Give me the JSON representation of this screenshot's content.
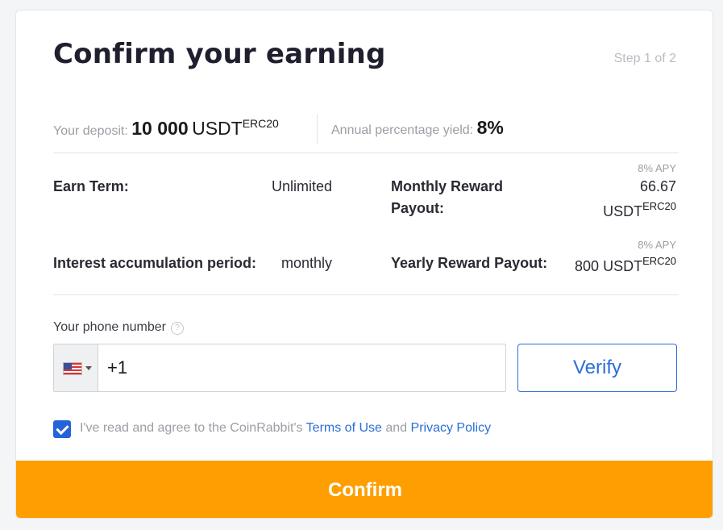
{
  "header": {
    "title": "Confirm your earning",
    "step": "Step 1 of 2"
  },
  "summary": {
    "deposit_label": "Your deposit:",
    "deposit_amount": "10 000",
    "deposit_currency": "USDT",
    "deposit_network": "ERC20",
    "apy_label": "Annual percentage yield:",
    "apy_value": "8%"
  },
  "details": {
    "earn_term_label": "Earn Term:",
    "earn_term_value": "Unlimited",
    "monthly_label_line1": "Monthly Reward",
    "monthly_label_line2": "Payout:",
    "monthly_apy_note": "8% APY",
    "monthly_amount": "66.67",
    "monthly_currency": "USDT",
    "monthly_network": "ERC20",
    "interest_period_label": "Interest accumulation period:",
    "interest_period_value": "monthly",
    "yearly_label": "Yearly Reward Payout:",
    "yearly_apy_note": "8% APY",
    "yearly_amount": "800 USDT",
    "yearly_network": "ERC20"
  },
  "phone": {
    "label": "Your phone number",
    "help_icon": "question-circle-icon",
    "country_flag": "us-flag-icon",
    "value": "+1",
    "verify_label": "Verify"
  },
  "agreement": {
    "checked": true,
    "text_prefix": "I've read and agree to the CoinRabbit's ",
    "terms_link": "Terms of Use",
    "text_middle": " and ",
    "privacy_link": "Privacy Policy"
  },
  "footer": {
    "confirm_label": "Confirm"
  },
  "colors": {
    "accent": "#ff9e00",
    "link": "#2b6fd6",
    "checkbox": "#2563d9"
  }
}
